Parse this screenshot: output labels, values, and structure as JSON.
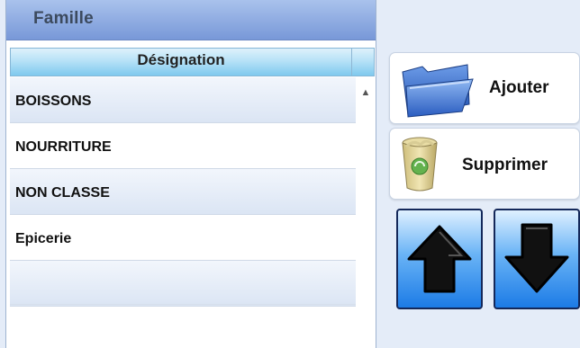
{
  "panel": {
    "title": "Famille",
    "column_header": "Désignation",
    "rows": [
      "BOISSONS",
      "NOURRITURE",
      "NON CLASSE",
      "Epicerie",
      ""
    ]
  },
  "buttons": {
    "add_label": "Ajouter",
    "delete_label": "Supprimer"
  },
  "icons": {
    "add": "folder-icon",
    "delete": "recycle-bin-icon",
    "up": "arrow-up-icon",
    "down": "arrow-down-icon",
    "scroll": "scroll-up-arrow-icon"
  },
  "colors": {
    "header_blue": "#7898d8",
    "column_header_cyan": "#7fc9ee",
    "arrow_button_blue": "#1c7be6"
  }
}
